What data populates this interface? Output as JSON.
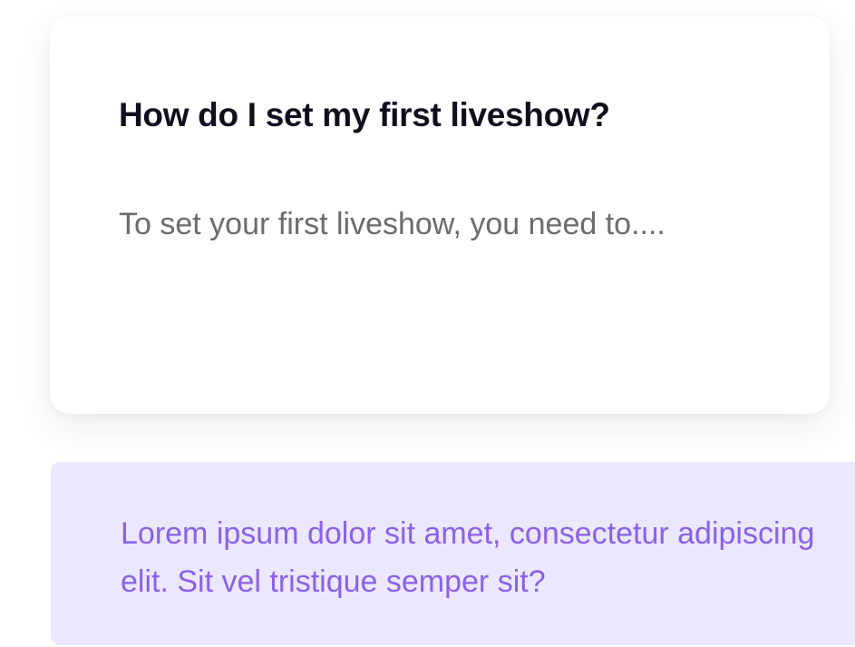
{
  "faq_card": {
    "question": "How do I set my first liveshow?",
    "answer": "To set your first liveshow, you need to...."
  },
  "faq_collapsed": {
    "question": "Lorem ipsum dolor sit amet, consectetur adipiscing elit. Sit vel tristique semper sit?"
  },
  "colors": {
    "card_background": "#ffffff",
    "question_text": "#0f0f1e",
    "answer_text": "#6b6b70",
    "collapsed_background": "#ebe7fc",
    "collapsed_text": "#8b61e8"
  }
}
